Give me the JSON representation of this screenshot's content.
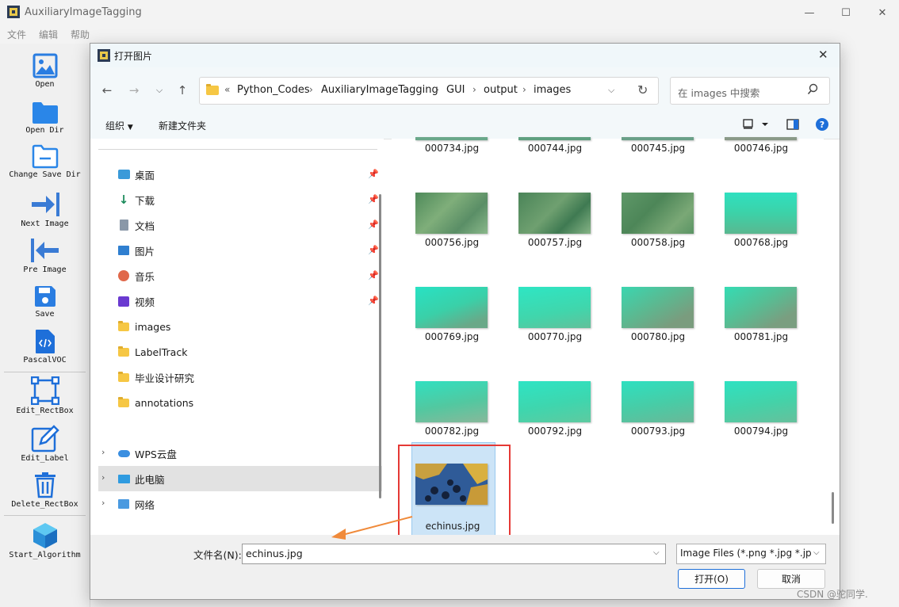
{
  "app": {
    "title": "AuxiliaryImageTagging",
    "menu": [
      "文件",
      "编辑",
      "帮助"
    ],
    "controls": [
      "—",
      "☐",
      "✕"
    ]
  },
  "toolbar": [
    {
      "label": "Open",
      "icon": "image-icon"
    },
    {
      "label": "Open Dir",
      "icon": "folder-icon"
    },
    {
      "label": "Change Save Dir",
      "icon": "folder-outline-icon"
    },
    {
      "label": "Next Image",
      "icon": "arrow-right-icon"
    },
    {
      "label": "Pre Image",
      "icon": "arrow-left-icon"
    },
    {
      "label": "Save",
      "icon": "floppy-icon"
    },
    {
      "label": "PascalVOC",
      "icon": "code-file-icon"
    },
    {
      "label": "Edit_RectBox",
      "icon": "rectbox-icon"
    },
    {
      "label": "Edit_Label",
      "icon": "pencil-icon"
    },
    {
      "label": "Delete_RectBox",
      "icon": "trash-icon"
    },
    {
      "label": "Start_Algorithm",
      "icon": "cube-icon"
    }
  ],
  "dialog": {
    "title": "打开图片",
    "address": {
      "prefix": "«",
      "crumbs": [
        "Python_Codes",
        "AuxiliaryImageTagging",
        "GUI",
        "output",
        "images"
      ]
    },
    "search_placeholder": "在 images 中搜索",
    "commands": {
      "organize": "组织",
      "new_folder": "新建文件夹"
    },
    "sidebar": {
      "quick_access": [
        {
          "label": "桌面",
          "pinned": true,
          "icon": "desktop-icon"
        },
        {
          "label": "下载",
          "pinned": true,
          "icon": "download-icon"
        },
        {
          "label": "文档",
          "pinned": true,
          "icon": "document-icon"
        },
        {
          "label": "图片",
          "pinned": true,
          "icon": "pictures-icon"
        },
        {
          "label": "音乐",
          "pinned": true,
          "icon": "music-icon"
        },
        {
          "label": "视频",
          "pinned": true,
          "icon": "video-icon"
        },
        {
          "label": "images",
          "pinned": false,
          "icon": "folder-icon"
        },
        {
          "label": "LabelTrack",
          "pinned": false,
          "icon": "folder-icon"
        },
        {
          "label": "毕业设计研究",
          "pinned": false,
          "icon": "folder-icon"
        },
        {
          "label": "annotations",
          "pinned": false,
          "icon": "folder-icon"
        }
      ],
      "locations": [
        {
          "label": "WPS云盘",
          "icon": "cloud-icon",
          "selected": false
        },
        {
          "label": "此电脑",
          "icon": "computer-icon",
          "selected": true
        },
        {
          "label": "网络",
          "icon": "network-icon",
          "selected": false
        }
      ]
    },
    "files": [
      {
        "name": "000734.jpg",
        "tone": "murky"
      },
      {
        "name": "000744.jpg",
        "tone": "murky"
      },
      {
        "name": "000745.jpg",
        "tone": "murky"
      },
      {
        "name": "000746.jpg",
        "tone": "murky"
      },
      {
        "name": "000756.jpg",
        "tone": "murky"
      },
      {
        "name": "000757.jpg",
        "tone": "murky"
      },
      {
        "name": "000758.jpg",
        "tone": "murky"
      },
      {
        "name": "000768.jpg",
        "tone": "bright"
      },
      {
        "name": "000769.jpg",
        "tone": "bright"
      },
      {
        "name": "000770.jpg",
        "tone": "bright"
      },
      {
        "name": "000780.jpg",
        "tone": "rocky"
      },
      {
        "name": "000781.jpg",
        "tone": "rocky"
      },
      {
        "name": "000782.jpg",
        "tone": "bright"
      },
      {
        "name": "000792.jpg",
        "tone": "bright"
      },
      {
        "name": "000793.jpg",
        "tone": "bright"
      },
      {
        "name": "000794.jpg",
        "tone": "bright"
      },
      {
        "name": "echinus.jpg",
        "tone": "echinus",
        "selected": true
      }
    ],
    "filename_label": "文件名(N):",
    "filename_value": "echinus.jpg",
    "filter_value": "Image Files (*.png *.jpg *.jpe",
    "open_button": "打开(O)",
    "cancel_button": "取消"
  },
  "annotation": {
    "highlight_color": "#e53935",
    "arrow_color": "#f08a3a"
  },
  "watermark": "CSDN @驼同学."
}
